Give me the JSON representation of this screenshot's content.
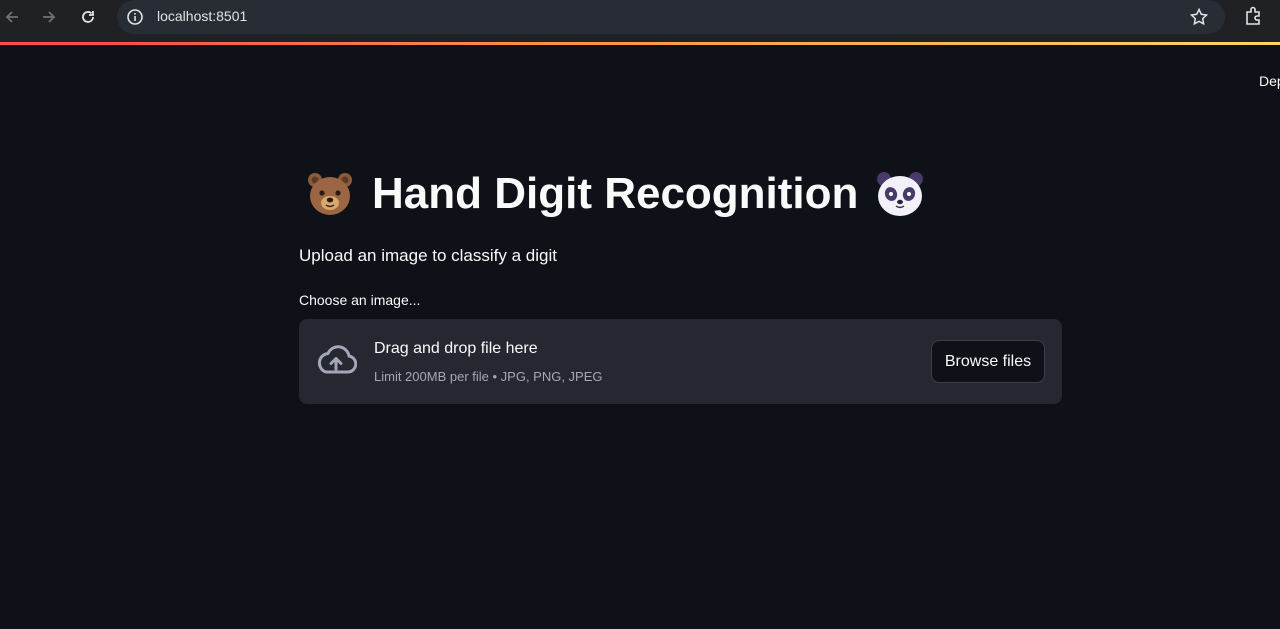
{
  "browser": {
    "url": "localhost:8501",
    "icons": [
      "back-arrow-icon",
      "forward-arrow-icon",
      "reload-icon",
      "site-info-icon",
      "bookmark-star-icon",
      "extensions-icon"
    ]
  },
  "header": {
    "deploy_label": "Dep"
  },
  "main": {
    "title": "Hand Digit Recognition",
    "title_emoji_left": "bear-face",
    "title_emoji_right": "panda-face",
    "subtitle": "Upload an image to classify a digit",
    "uploader": {
      "label": "Choose an image...",
      "drop_text": "Drag and drop file here",
      "limit_text": "Limit 200MB per file • JPG, PNG, JPEG",
      "button_label": "Browse files",
      "icon": "cloud-upload-icon"
    }
  },
  "colors": {
    "background": "#0e1117",
    "dropzone": "#262730",
    "accent": "#ff4b4b",
    "muted_text": "#a3a8b8"
  }
}
